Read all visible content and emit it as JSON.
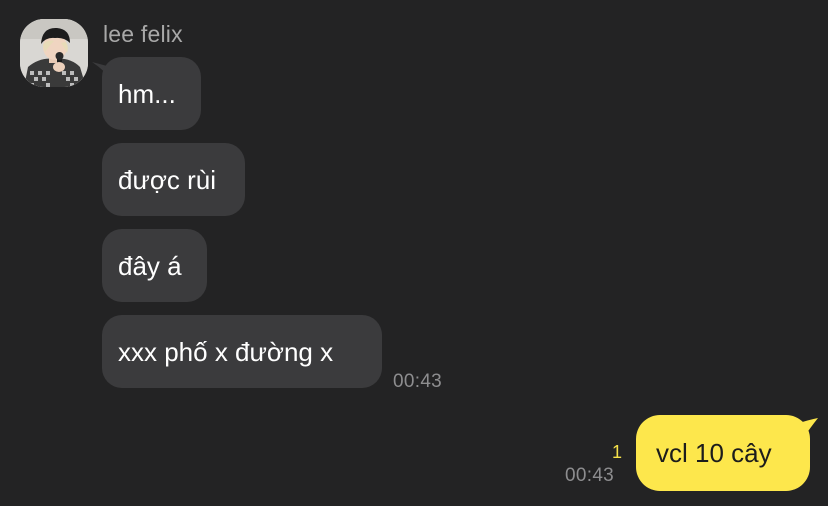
{
  "contact": {
    "name": "lee felix",
    "avatar_icon": "profile-photo-avatar"
  },
  "incoming_messages": [
    {
      "text": "hm..."
    },
    {
      "text": "được rùi"
    },
    {
      "text": "đây á"
    },
    {
      "text": "xxx phố x đường x"
    }
  ],
  "incoming_time": "00:43",
  "outgoing_message": {
    "text": "vcl 10 cây",
    "unread_count": "1",
    "time": "00:43"
  },
  "colors": {
    "background": "#232324",
    "incoming_bubble": "#3b3b3d",
    "outgoing_bubble": "#fde74c",
    "unread_count": "#f5e14a"
  }
}
